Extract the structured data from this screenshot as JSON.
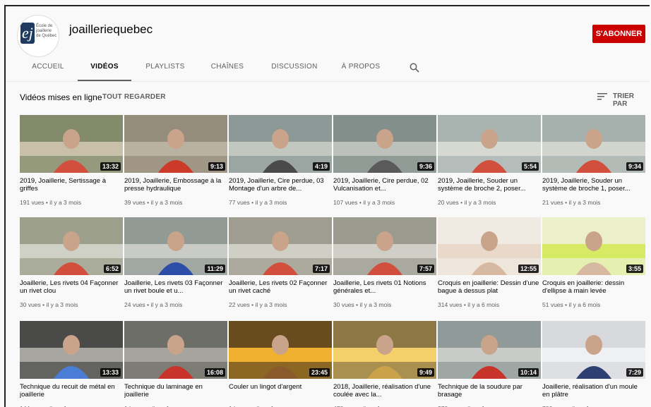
{
  "channel": {
    "name": "joailleriequebec",
    "avatar_text": "École de joaillerie de Québec",
    "subscribe_label": "S'ABONNER"
  },
  "tabs": [
    "ACCUEIL",
    "VIDÉOS",
    "PLAYLISTS",
    "CHAÎNES",
    "DISCUSSION",
    "À PROPOS"
  ],
  "active_tab": "VIDÉOS",
  "section": {
    "title": "Vidéos mises en ligne",
    "see_all": "TOUT REGARDER",
    "sort_label": "TRIER PAR"
  },
  "icons": {
    "search": "search-icon",
    "sort": "sort-icon"
  },
  "videos": [
    {
      "title": "2019, Joaillerie, Sertissage à griffes",
      "meta": "191 vues • il y a 3 mois",
      "duration": "13:32",
      "palette": [
        "#6e7a5a",
        "#c8c0a8",
        "#d14f3c"
      ]
    },
    {
      "title": "2019, Joaillerie, Embossage à la presse hydraulique",
      "meta": "39 vues • il y a 3 mois",
      "duration": "9:13",
      "palette": [
        "#8a8070",
        "#b9b2a0",
        "#cc3a2a"
      ]
    },
    {
      "title": "2019, Joaillerie, Cire perdue, 03 Montage d'un arbre de...",
      "meta": "77 vues • il y a 3 mois",
      "duration": "4:19",
      "palette": [
        "#7b8a88",
        "#c2c7c0",
        "#4a4a4a"
      ]
    },
    {
      "title": "2019, Joaillerie, Cire perdue, 02 Vulcanisation et...",
      "meta": "107 vues • il y a 3 mois",
      "duration": "9:36",
      "palette": [
        "#6f7d7a",
        "#bcc1bb",
        "#5a5a5a"
      ]
    },
    {
      "title": "2019, Joaillerie, Souder un système de broche 2, poser...",
      "meta": "20 vues • il y a 3 mois",
      "duration": "5:54",
      "palette": [
        "#9aa8a6",
        "#d6d8d2",
        "#d14f3c"
      ]
    },
    {
      "title": "2019, Joaillerie, Souder un système de broche 1, poser...",
      "meta": "21 vues • il y a 3 mois",
      "duration": "9:34",
      "palette": [
        "#97a5a2",
        "#d2d4ce",
        "#d14f3c"
      ]
    },
    {
      "title": "Joaillerie, Les rivets 04 Façonner un rivet clou",
      "meta": "30 vues • il y a 3 mois",
      "duration": "6:52",
      "palette": [
        "#8c8f7a",
        "#cfd0c6",
        "#d14f3c"
      ]
    },
    {
      "title": "Joaillerie, Les rivets 03 Façonner un rivet boule et u...",
      "meta": "24 vues • il y a 3 mois",
      "duration": "11:29",
      "palette": [
        "#7f8a86",
        "#c9ccc6",
        "#2d4ea8"
      ]
    },
    {
      "title": "Joaillerie, Les rivets 02 Façonner un rivet caché",
      "meta": "22 vues • il y a 3 mois",
      "duration": "7:17",
      "palette": [
        "#8d8c7c",
        "#d0cfc6",
        "#d14f3c"
      ]
    },
    {
      "title": "Joaillerie, Les rivets 01 Notions générales et...",
      "meta": "30 vues • il y a 3 mois",
      "duration": "7:57",
      "palette": [
        "#8a8a7d",
        "#cfcfc8",
        "#d14f3c"
      ]
    },
    {
      "title": "Croquis en joaillerie: Dessin d'une bague à dessus plat",
      "meta": "314 vues • il y a 6 mois",
      "duration": "12:55",
      "palette": [
        "#f3efe9",
        "#e8d9cb",
        "#d7b9a2"
      ]
    },
    {
      "title": "Croquis en joaillerie: dessin d'ellipse à main levée",
      "meta": "51 vues • il y a 6 mois",
      "duration": "3:55",
      "palette": [
        "#f2f2ee",
        "#d6ea63",
        "#d7b9a2"
      ]
    },
    {
      "title": "Technique du recuit de métal en joaillerie",
      "meta": "144 vues • il y a 1 an",
      "duration": "13:33",
      "palette": [
        "#2b2b2b",
        "#a7a6a0",
        "#4a7dd6"
      ]
    },
    {
      "title": "Technique du laminage en joaillerie",
      "meta": "1 k vues • il y a 1 an",
      "duration": "16:08",
      "palette": [
        "#5b5c58",
        "#a6a49c",
        "#c8332a"
      ]
    },
    {
      "title": "Couler un lingot d'argent",
      "meta": "1 k vues • il y a 1 an",
      "duration": "23:45",
      "palette": [
        "#3b2a1a",
        "#f0b030",
        "#8b5a2b"
      ]
    },
    {
      "title": "2018, Joaillerie, réalisation d'une coulée avec la...",
      "meta": "478 vues • il y a 1 an",
      "duration": "9:49",
      "palette": [
        "#6b5a3a",
        "#f3d06a",
        "#c9a24a"
      ]
    },
    {
      "title": "Technique de la soudure par brasage",
      "meta": "370 vues • il y a 1 an",
      "duration": "10:14",
      "palette": [
        "#7e8b8a",
        "#c8cbc6",
        "#c8332a"
      ]
    },
    {
      "title": "Joaillerie, réalisation d'un moule en plâtre",
      "meta": "786 vues • il y a 1 an",
      "duration": "7:29",
      "palette": [
        "#cfd2d6",
        "#eef0f2",
        "#2d3f73"
      ]
    }
  ]
}
